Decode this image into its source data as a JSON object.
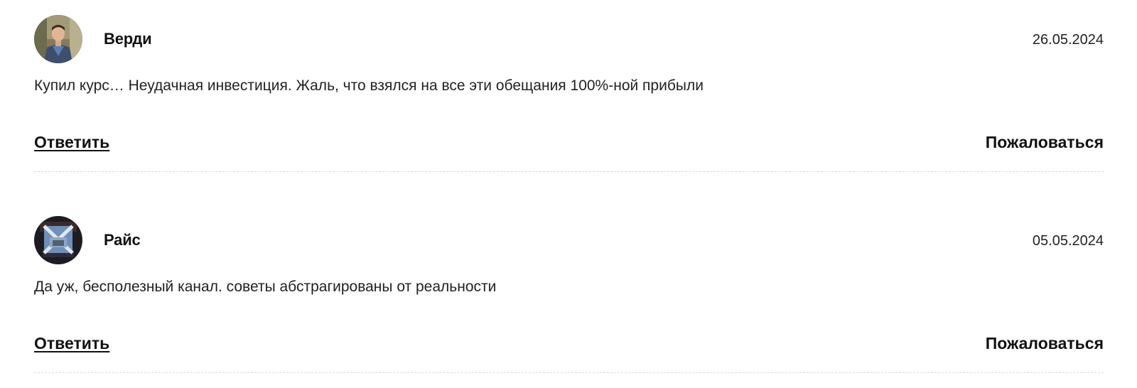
{
  "comments": [
    {
      "author": "Верди",
      "date": "26.05.2024",
      "text": "Купил курс… Неудачная инвестиция. Жаль, что взялся на все эти обещания 100%-ной прибыли",
      "reply_label": "Ответить",
      "complain_label": "Пожаловаться",
      "avatar": "photo-avatar-man-in-blue-shirt"
    },
    {
      "author": "Райс",
      "date": "05.05.2024",
      "text": "Да уж, бесполезный канал. советы абстрагированы от реальности",
      "reply_label": "Ответить",
      "complain_label": "Пожаловаться",
      "avatar": "logo-avatar-blue-emblem"
    }
  ]
}
